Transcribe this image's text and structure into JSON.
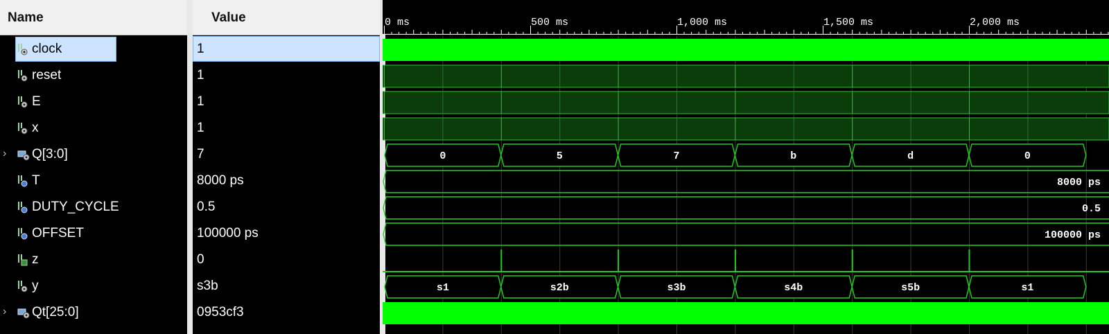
{
  "header": {
    "name": "Name",
    "value": "Value"
  },
  "colors": {
    "wave_bright": "#00ff00",
    "wave_dark": "#0b3d0b",
    "edge": "#22cc22"
  },
  "timeline": {
    "ticks": [
      {
        "t": 0,
        "label": "0 ms"
      },
      {
        "t": 500,
        "label": "500 ms"
      },
      {
        "t": 1000,
        "label": "1,000 ms"
      },
      {
        "t": 1500,
        "label": "1,500 ms"
      },
      {
        "t": 2000,
        "label": "2,000 ms"
      }
    ],
    "segment_boundaries": [
      0,
      400,
      800,
      1200,
      1600,
      2000
    ]
  },
  "signals": [
    {
      "name": "clock",
      "value": "1",
      "icon": "scalar-signal-icon",
      "selected": true,
      "wave": "bright"
    },
    {
      "name": "reset",
      "value": "1",
      "icon": "scalar-signal-icon",
      "wave": "dark"
    },
    {
      "name": "E",
      "value": "1",
      "icon": "scalar-signal-icon",
      "wave": "dark"
    },
    {
      "name": "x",
      "value": "1",
      "icon": "scalar-signal-icon",
      "wave": "dark"
    },
    {
      "name": "Q[3:0]",
      "value": "7",
      "icon": "bus-signal-icon",
      "expandable": true,
      "wave": "bus",
      "segments": [
        "0",
        "5",
        "7",
        "b",
        "d",
        "0"
      ]
    },
    {
      "name": "T",
      "value": "8000 ps",
      "icon": "parameter-icon",
      "wave": "const",
      "wave_label": "8000 ps"
    },
    {
      "name": "DUTY_CYCLE",
      "value": "0.5",
      "icon": "parameter-icon",
      "wave": "const",
      "wave_label": "0.5"
    },
    {
      "name": "OFFSET",
      "value": "100000 ps",
      "icon": "parameter-icon",
      "wave": "const",
      "wave_label": "100000 ps"
    },
    {
      "name": "z",
      "value": "0",
      "icon": "output-signal-icon",
      "wave": "low"
    },
    {
      "name": "y",
      "value": "s3b",
      "icon": "scalar-signal-icon",
      "wave": "bus",
      "segments": [
        "s1",
        "s2b",
        "s3b",
        "s4b",
        "s5b",
        "s1"
      ]
    },
    {
      "name": "Qt[25:0]",
      "value": "0953cf3",
      "icon": "bus-signal-icon",
      "expandable": true,
      "wave": "bright"
    }
  ]
}
